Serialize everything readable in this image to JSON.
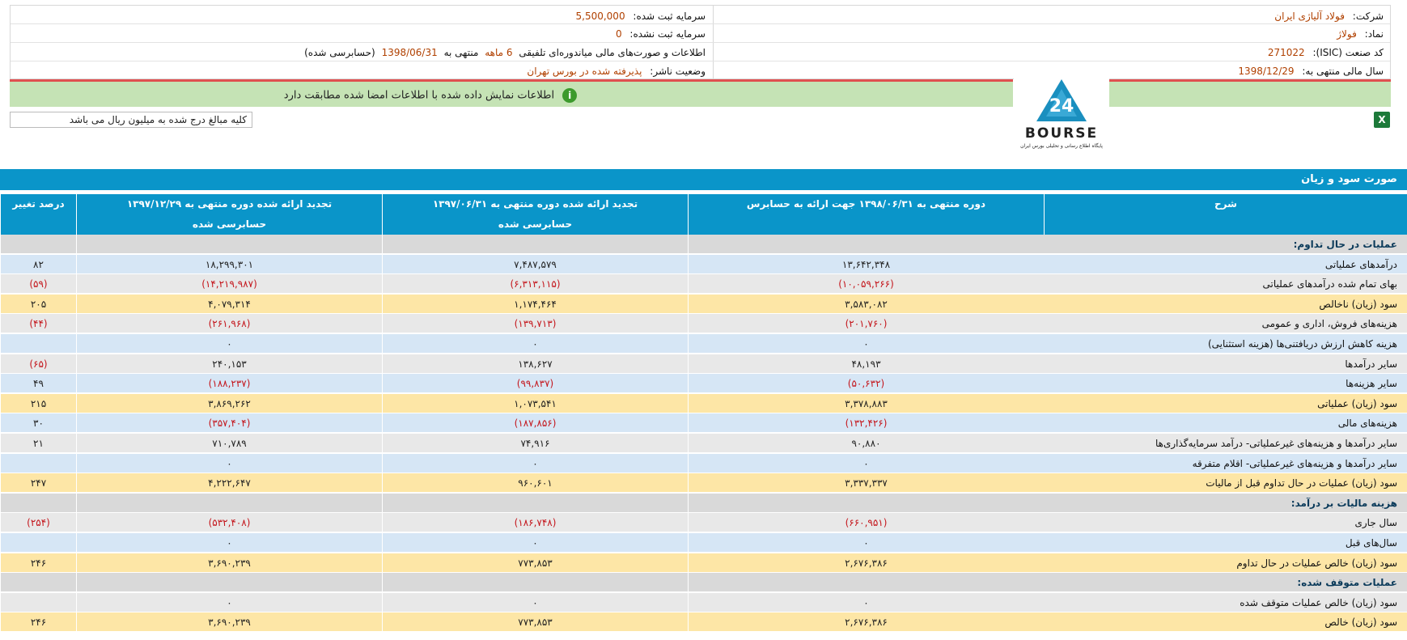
{
  "header": {
    "company_label": "شرکت:",
    "company_value": "فولاد آلیاژی ایران",
    "symbol_label": "نماد:",
    "symbol_value": "فولاژ",
    "isic_label": "کد صنعت (ISIC):",
    "isic_value": "271022",
    "fiscal_label": "سال مالی منتهی به:",
    "fiscal_value": "1398/12/29",
    "registered_capital_label": "سرمایه ثبت شده:",
    "registered_capital_value": "5,500,000",
    "unregistered_capital_label": "سرمایه ثبت نشده:",
    "unregistered_capital_value": "0",
    "report_text_a": "اطلاعات و صورت‌های مالی میاندوره‌ای تلفیقی",
    "report_text_b": "6 ماهه",
    "report_text_c": "منتهی به",
    "report_text_d": "1398/06/31",
    "report_text_e": "(حسابرسی شده)",
    "publisher_status_label": "وضعیت ناشر:",
    "publisher_status_value": "پذیرفته شده در بورس تهران"
  },
  "infobar": {
    "message": "اطلاعات نمایش داده شده با اطلاعات امضا شده مطابقت دارد",
    "icon": "info-icon"
  },
  "note": "کلیه مبالغ درج شده به میلیون ریال می باشد",
  "logo": {
    "text": "BOURSE",
    "sub": "پایگاه اطلاع رسانی و تحلیلی بورس ایران",
    "num": "24"
  },
  "excel_icon": "excel-icon",
  "section_title": "صورت سود و زیان",
  "table": {
    "headers": {
      "description": "شرح",
      "col1": "دوره منتهی به ۱۳۹۸/۰۶/۳۱ جهت ارائه به حسابرس",
      "col2": "تجدید ارائه شده دوره منتهی به ۱۳۹۷/۰۶/۳۱",
      "col3": "تجدید ارائه شده دوره منتهی به ۱۳۹۷/۱۲/۲۹",
      "col4": "درصد تغییر",
      "col2_sub": "حسابرسی شده",
      "col3_sub": "حسابرسی شده"
    },
    "rows": [
      {
        "label": "عملیات در حال تداوم:",
        "c1": "",
        "c2": "",
        "c3": "",
        "c4": "",
        "style": "head"
      },
      {
        "label": "درآمدهای عملیاتی",
        "c1": "۱۳,۶۴۲,۳۴۸",
        "c2": "۷,۴۸۷,۵۷۹",
        "c3": "۱۸,۲۹۹,۳۰۱",
        "c4": "۸۲",
        "style": "blue"
      },
      {
        "label": "بهای تمام شده درآمدهای عملیاتی",
        "c1": "(۱۰,۰۵۹,۲۶۶)",
        "c2": "(۶,۳۱۳,۱۱۵)",
        "c3": "(۱۴,۲۱۹,۹۸۷)",
        "c4": "(۵۹)",
        "style": "gray",
        "neg": true
      },
      {
        "label": "سود (زیان) ناخالص",
        "c1": "۳,۵۸۳,۰۸۲",
        "c2": "۱,۱۷۴,۴۶۴",
        "c3": "۴,۰۷۹,۳۱۴",
        "c4": "۲۰۵",
        "style": "yellow"
      },
      {
        "label": "هزینه‌های فروش، اداری و عمومی",
        "c1": "(۲۰۱,۷۶۰)",
        "c2": "(۱۳۹,۷۱۳)",
        "c3": "(۲۶۱,۹۶۸)",
        "c4": "(۴۴)",
        "style": "gray",
        "neg": true
      },
      {
        "label": "هزینه کاهش ارزش دریافتنی‌ها (هزینه استثنایی)",
        "c1": "۰",
        "c2": "۰",
        "c3": "۰",
        "c4": "",
        "style": "blue"
      },
      {
        "label": "سایر درآمدها",
        "c1": "۴۸,۱۹۳",
        "c2": "۱۳۸,۶۲۷",
        "c3": "۲۴۰,۱۵۳",
        "c4": "(۶۵)",
        "style": "gray",
        "neg4": true
      },
      {
        "label": "سایر هزینه‌ها",
        "c1": "(۵۰,۶۳۲)",
        "c2": "(۹۹,۸۳۷)",
        "c3": "(۱۸۸,۲۳۷)",
        "c4": "۴۹",
        "style": "blue",
        "neg": true,
        "pos4": true
      },
      {
        "label": "سود (زیان) عملیاتی",
        "c1": "۳,۳۷۸,۸۸۳",
        "c2": "۱,۰۷۳,۵۴۱",
        "c3": "۳,۸۶۹,۲۶۲",
        "c4": "۲۱۵",
        "style": "yellow"
      },
      {
        "label": "هزینه‌های مالی",
        "c1": "(۱۳۲,۴۲۶)",
        "c2": "(۱۸۷,۸۵۶)",
        "c3": "(۳۵۷,۴۰۴)",
        "c4": "۳۰",
        "style": "blue",
        "neg": true,
        "pos4": true
      },
      {
        "label": "سایر درآمدها و هزینه‌های غیرعملیاتی- درآمد سرمایه‌گذاری‌ها",
        "c1": "۹۰,۸۸۰",
        "c2": "۷۴,۹۱۶",
        "c3": "۷۱۰,۷۸۹",
        "c4": "۲۱",
        "style": "gray"
      },
      {
        "label": "سایر درآمدها و هزینه‌های غیرعملیاتی- اقلام متفرقه",
        "c1": "۰",
        "c2": "۰",
        "c3": "۰",
        "c4": "",
        "style": "blue"
      },
      {
        "label": "سود (زیان) عملیات در حال تداوم قبل از مالیات",
        "c1": "۳,۳۳۷,۳۳۷",
        "c2": "۹۶۰,۶۰۱",
        "c3": "۴,۲۲۲,۶۴۷",
        "c4": "۲۴۷",
        "style": "yellow"
      },
      {
        "label": "هزینه مالیات بر درآمد:",
        "c1": "",
        "c2": "",
        "c3": "",
        "c4": "",
        "style": "head"
      },
      {
        "label": "سال جاری",
        "c1": "(۶۶۰,۹۵۱)",
        "c2": "(۱۸۶,۷۴۸)",
        "c3": "(۵۳۲,۴۰۸)",
        "c4": "(۲۵۴)",
        "style": "gray",
        "neg": true
      },
      {
        "label": "سال‌های قبل",
        "c1": "۰",
        "c2": "۰",
        "c3": "۰",
        "c4": "",
        "style": "blue"
      },
      {
        "label": "سود (زیان) خالص عملیات در حال تداوم",
        "c1": "۲,۶۷۶,۳۸۶",
        "c2": "۷۷۳,۸۵۳",
        "c3": "۳,۶۹۰,۲۳۹",
        "c4": "۲۴۶",
        "style": "yellow"
      },
      {
        "label": "عملیات متوقف شده:",
        "c1": "",
        "c2": "",
        "c3": "",
        "c4": "",
        "style": "head"
      },
      {
        "label": "سود (زیان) خالص عملیات متوقف شده",
        "c1": "۰",
        "c2": "۰",
        "c3": "۰",
        "c4": "",
        "style": "gray"
      },
      {
        "label": "سود (زیان) خالص",
        "c1": "۲,۶۷۶,۳۸۶",
        "c2": "۷۷۳,۸۵۳",
        "c3": "۳,۶۹۰,۲۳۹",
        "c4": "۲۴۶",
        "style": "yellow"
      }
    ]
  }
}
